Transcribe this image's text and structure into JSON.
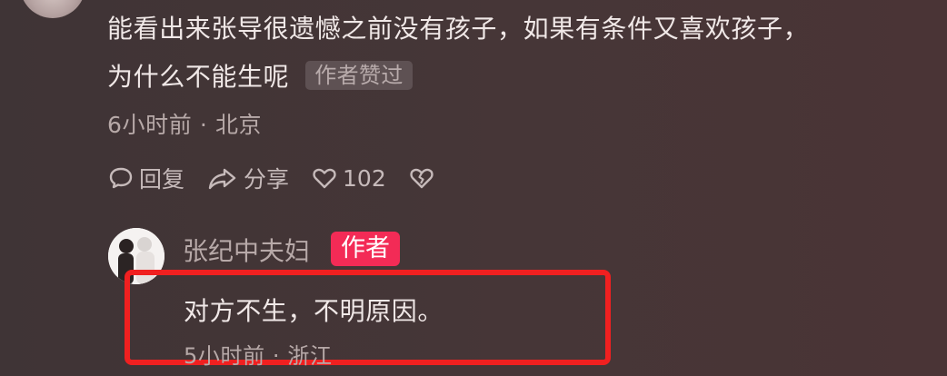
{
  "comment": {
    "line1": "能看出来张导很遗憾之前没有孩子，如果有条件又喜欢孩子，",
    "line2": "为什么不能生呢",
    "liked_badge": "作者赞过",
    "meta": "6小时前 · 北京",
    "actions": {
      "reply": "回复",
      "share": "分享",
      "likes": "102"
    },
    "icons": {
      "reply": "reply-bubble-icon",
      "share": "share-arrow-icon",
      "like": "heart-icon",
      "dislike": "broken-heart-icon"
    }
  },
  "reply": {
    "author_name": "张纪中夫妇",
    "author_tag": "作者",
    "text": "对方不生，不明原因。",
    "meta": "5小时前 · 浙江"
  },
  "colors": {
    "background": "#433537",
    "highlight_border": "#f02020",
    "author_tag": "#f32b56"
  }
}
